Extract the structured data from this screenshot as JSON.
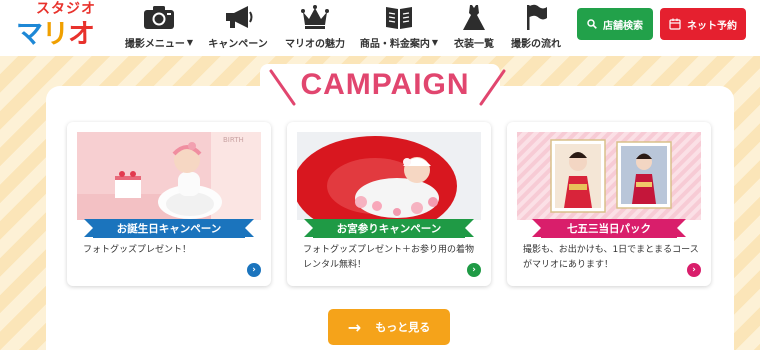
{
  "logo": {
    "top": "スタジオ",
    "main": [
      "マ",
      "リ",
      "オ"
    ]
  },
  "nav": [
    {
      "label": "撮影メニュー",
      "icon": "camera-icon",
      "dropdown": true
    },
    {
      "label": "キャンペーン",
      "icon": "megaphone-icon",
      "dropdown": false
    },
    {
      "label": "マリオの魅力",
      "icon": "crown-icon",
      "dropdown": false
    },
    {
      "label": "商品・料金案内",
      "icon": "book-icon",
      "dropdown": true
    },
    {
      "label": "衣装一覧",
      "icon": "dress-icon",
      "dropdown": false
    },
    {
      "label": "撮影の流れ",
      "icon": "flag-icon",
      "dropdown": false
    }
  ],
  "header_buttons": {
    "store_search": "店舗検索",
    "reserve": "ネット予約"
  },
  "section_title": "CAMPAIGN",
  "cards": [
    {
      "ribbon": "お誕生日キャンペーン",
      "desc": "フォトグッズプレゼント！",
      "color": "#1b74bd"
    },
    {
      "ribbon": "お宮参りキャンペーン",
      "desc": "フォトグッズプレゼント＋お参り用の着物レンタル無料！",
      "color": "#1f9a45"
    },
    {
      "ribbon": "七五三当日パック",
      "desc": "撮影も、お出かけも、1日でまとまるコースがマリオにあります！",
      "color": "#d91e6b"
    }
  ],
  "more_button": "もっと見る",
  "colors": {
    "accent_pink": "#e1466f",
    "store_green": "#22a14a",
    "reserve_red": "#e5202f",
    "more_orange": "#f5a31a"
  }
}
